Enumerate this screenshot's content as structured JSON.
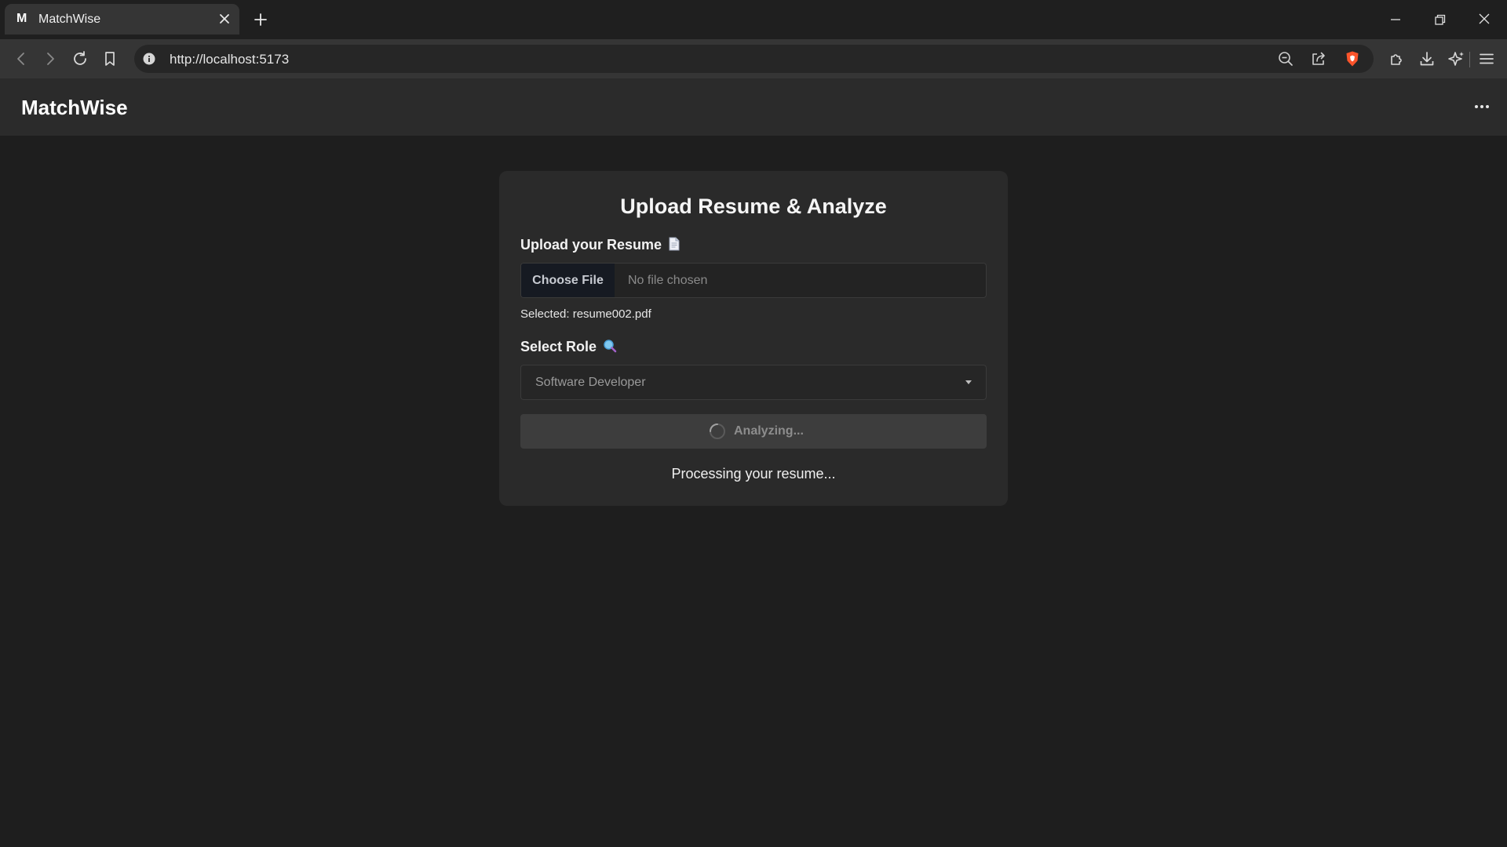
{
  "browser": {
    "tab": {
      "favicon_letter": "M",
      "title": "MatchWise"
    },
    "url": "http://localhost:5173"
  },
  "app": {
    "brand": "MatchWise"
  },
  "card": {
    "title": "Upload Resume & Analyze",
    "upload_label": "Upload your Resume",
    "upload_icon": "document-icon",
    "choose_file_label": "Choose File",
    "no_file_text": "No file chosen",
    "selected_text": "Selected: resume002.pdf",
    "role_label": "Select Role",
    "role_icon": "magnifier-icon",
    "role_value": "Software Developer",
    "analyze_label": "Analyzing...",
    "processing_text": "Processing your resume..."
  },
  "colors": {
    "page_bg": "#1e1e1e",
    "card_bg": "#2a2a2a",
    "appbar_bg": "#2b2b2b",
    "brave_orange": "#fb542b"
  }
}
